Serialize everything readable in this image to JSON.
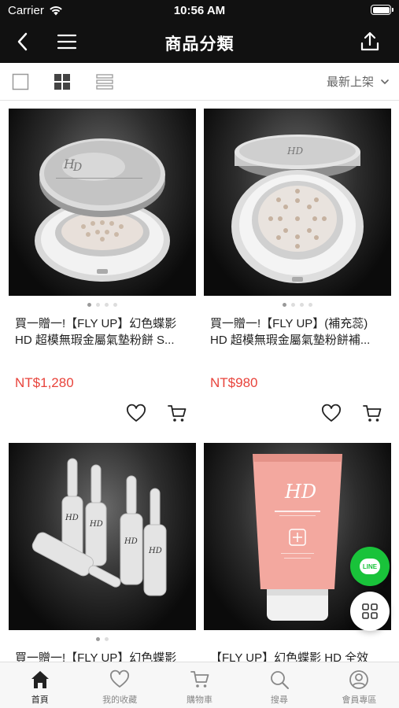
{
  "status_bar": {
    "carrier": "Carrier",
    "time": "10:56 AM"
  },
  "nav": {
    "title": "商品分類"
  },
  "toolbar": {
    "sort_label": "最新上架"
  },
  "products": [
    {
      "name_line1": "買一贈一!【FLY UP】幻色蝶影",
      "name_line2": "HD 超模無瑕金屬氣墊粉餅 S...",
      "price": "NT$1,280",
      "image_dots": 4
    },
    {
      "name_line1": "買一贈一!【FLY UP】(補充蕊)",
      "name_line2": "HD 超模無瑕金屬氣墊粉餅補...",
      "price": "NT$980",
      "image_dots": 4
    },
    {
      "name_line1": "買一贈一!【FLY UP】幻色蝶影",
      "name_line2": "",
      "price": "",
      "image_dots": 2
    },
    {
      "name_line1": "【FLY UP】幻色蝶影 HD 全效",
      "name_line2": "",
      "price": "",
      "image_dots": 0
    }
  ],
  "fab": {
    "line_label": "LINE"
  },
  "tabs": [
    {
      "label": "首頁",
      "icon": "home-icon"
    },
    {
      "label": "我的收藏",
      "icon": "heart-icon"
    },
    {
      "label": "購物車",
      "icon": "cart-icon"
    },
    {
      "label": "搜尋",
      "icon": "search-icon"
    },
    {
      "label": "會員專區",
      "icon": "user-icon"
    }
  ],
  "colors": {
    "accent_price": "#e8433b",
    "header_bg": "#111111",
    "line_green": "#19c33a"
  }
}
